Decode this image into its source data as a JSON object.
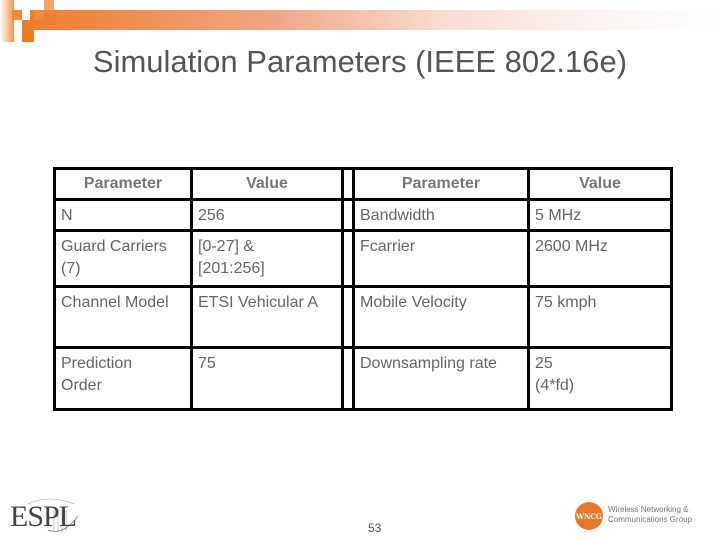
{
  "slide": {
    "title": "Simulation Parameters (IEEE 802.16e)",
    "page_number": "53"
  },
  "table": {
    "headers": [
      "Parameter",
      "Value",
      "",
      "Parameter",
      "Value"
    ],
    "rows": [
      {
        "param_left": "N",
        "value_left": "256",
        "param_right": "Bandwidth",
        "value_right": "5 MHz"
      },
      {
        "param_left": "Guard Carriers (7)",
        "value_left": "[0-27] & [201:256]",
        "param_right": "Fcarrier",
        "value_right": "2600 MHz"
      },
      {
        "param_left": "Channel Model",
        "value_left": "ETSI Vehicular A",
        "param_right": "Mobile Velocity",
        "value_right": "75 kmph"
      },
      {
        "param_left": "Prediction Order",
        "value_left": "75",
        "param_right": "Downsampling rate",
        "value_right": "25 (4*fd)"
      }
    ]
  },
  "logos": {
    "left": {
      "text": "ESPL"
    },
    "right": {
      "badge": "WNCG",
      "line1": "Wireless Networking &",
      "line2": "Communications Group"
    }
  },
  "colors": {
    "accent": "#ee7d2e",
    "text": "#666666",
    "border": "#000000"
  }
}
